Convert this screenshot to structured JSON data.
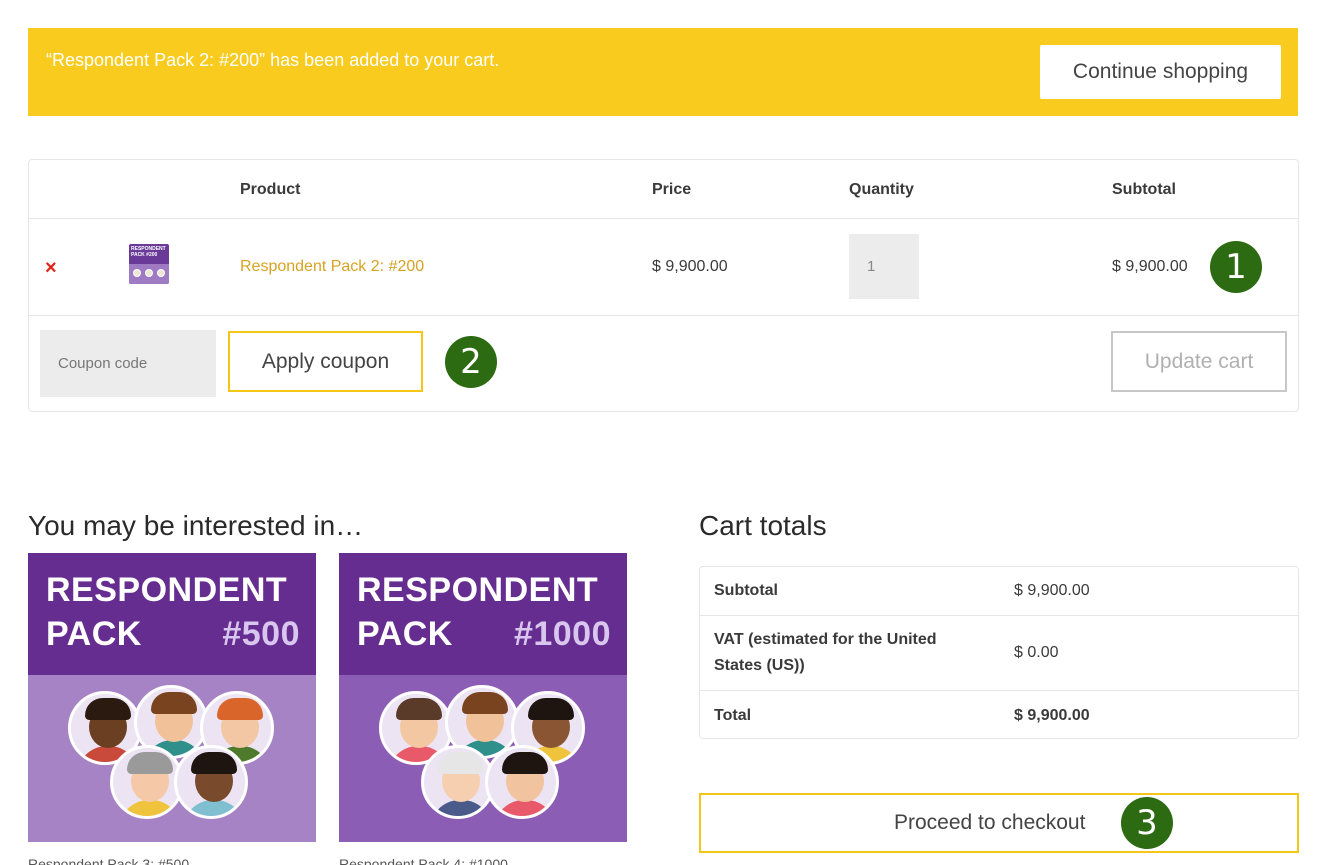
{
  "notice": {
    "message": "“Respondent Pack 2: #200” has been added to your cart.",
    "continue_label": "Continue shopping"
  },
  "cart": {
    "headers": {
      "product": "Product",
      "price": "Price",
      "quantity": "Quantity",
      "subtotal": "Subtotal"
    },
    "item": {
      "remove_glyph": "×",
      "thumb_text": "RESPONDENT PACK #200",
      "name": "Respondent Pack 2: #200",
      "price": "$ 9,900.00",
      "quantity": "1",
      "subtotal": "$ 9,900.00"
    },
    "coupon_placeholder": "Coupon code",
    "apply_label": "Apply coupon",
    "update_label": "Update cart"
  },
  "badges": {
    "b1": "1",
    "b2": "2",
    "b3": "3"
  },
  "upsells": {
    "title": "You may be interested in…",
    "items": [
      {
        "line1": "RESPONDENT",
        "line2": "PACK",
        "number": "#500",
        "name": "Respondent Pack 3: #500"
      },
      {
        "line1": "RESPONDENT",
        "line2": "PACK",
        "number": "#1000",
        "name": "Respondent Pack 4: #1000"
      }
    ]
  },
  "totals": {
    "title": "Cart totals",
    "subtotal_label": "Subtotal",
    "subtotal_value": "$ 9,900.00",
    "vat_label": "VAT (estimated for the United States (US))",
    "vat_value": "$ 0.00",
    "total_label": "Total",
    "total_value": "$ 9,900.00",
    "checkout_label": "Proceed to checkout"
  },
  "colors": {
    "notice_bg": "#f9cb1f",
    "accent_yellow": "#f5c518",
    "link": "#d6a322",
    "remove": "#e2231a",
    "badge": "#2d6b12",
    "pack_purple": "#662d91"
  }
}
